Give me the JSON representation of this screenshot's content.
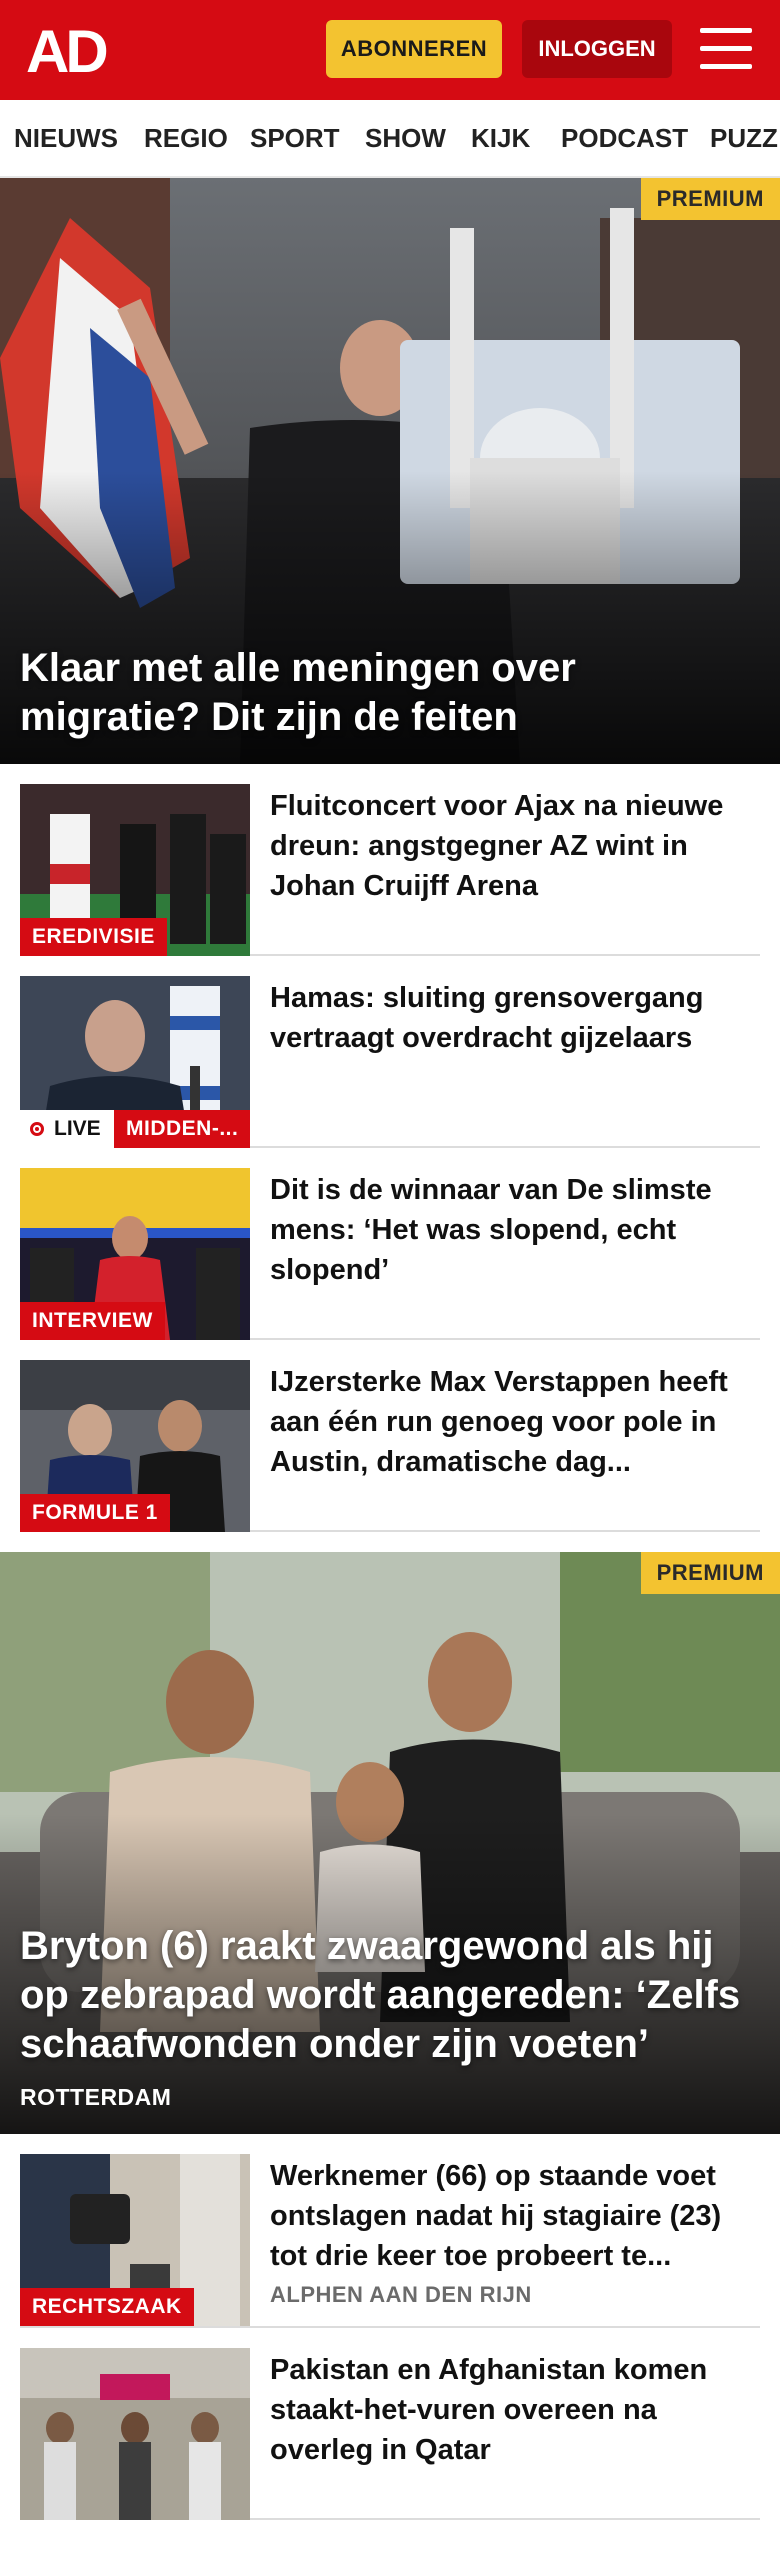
{
  "header": {
    "logo_text": "AD",
    "subscribe_label": "ABONNEREN",
    "login_label": "INLOGGEN",
    "menu_icon": "hamburger-menu-icon",
    "brand_color": "#d50b13",
    "accent_color": "#f3c330"
  },
  "nav": {
    "items": [
      "NIEUWS",
      "REGIO",
      "SPORT",
      "SHOW",
      "KIJK",
      "PODCAST",
      "PUZZ"
    ]
  },
  "hero1": {
    "badge": "PREMIUM",
    "title": "Klaar met alle meningen over migratie? Dit zijn de feiten"
  },
  "articles1": [
    {
      "tag": "EREDIVISIE",
      "headline": "Fluitconcert voor Ajax na nieuwe dreun: angstgegner AZ wint in Johan Cruijff Arena"
    },
    {
      "live": "LIVE",
      "tag": "MIDDEN-...",
      "headline": "Hamas: sluiting grensovergang vertraagt overdracht gijzelaars"
    },
    {
      "tag": "INTERVIEW",
      "headline": "Dit is de winnaar van De slimste mens: ‘Het was slopend, echt slopend’"
    },
    {
      "tag": "FORMULE 1",
      "headline": "IJzersterke Max Verstappen heeft aan één run genoeg voor pole in Austin, dramatische dag..."
    }
  ],
  "hero2": {
    "badge": "PREMIUM",
    "title": "Bryton (6) raakt zwaargewond als hij op zebrapad wordt aangereden: ‘Zelfs schaafwonden onder zijn voeten’",
    "location": "ROTTERDAM"
  },
  "articles2": [
    {
      "tag": "RECHTSZAAK",
      "headline": "Werknemer (66) op staande voet ontslagen nadat hij stagiaire (23) tot drie keer toe probeert te...",
      "location": "ALPHEN AAN DEN RIJN"
    },
    {
      "headline": "Pakistan en Afghanistan komen staakt-het-vuren overeen na overleg in Qatar"
    }
  ]
}
